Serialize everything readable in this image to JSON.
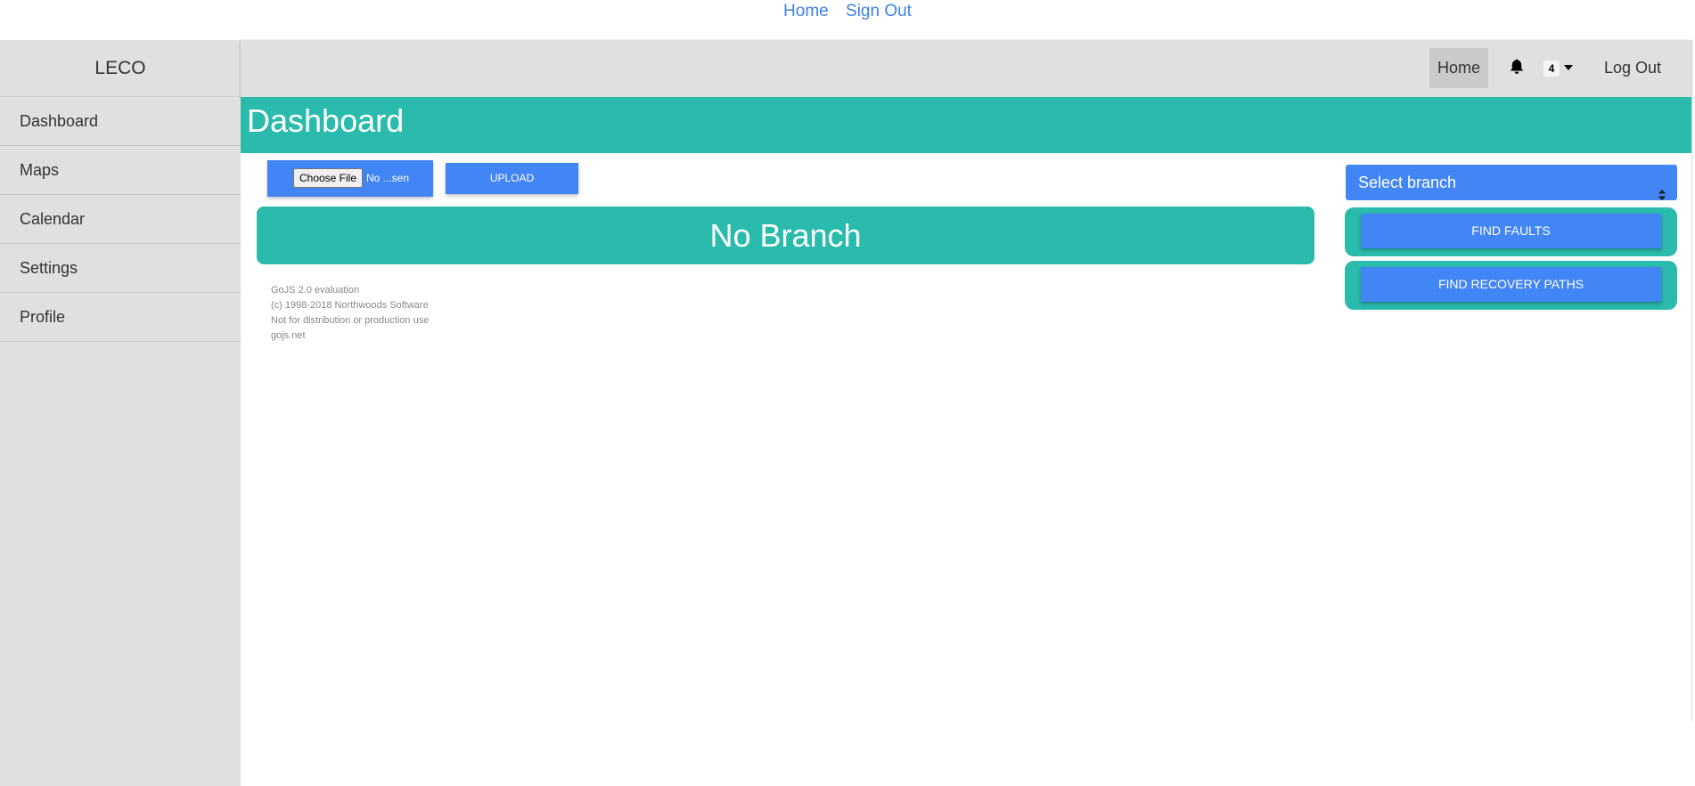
{
  "top_links": {
    "home": "Home",
    "sign_out": "Sign Out"
  },
  "sidebar": {
    "brand": "LECO",
    "items": [
      {
        "label": "Dashboard"
      },
      {
        "label": "Maps"
      },
      {
        "label": "Calendar"
      },
      {
        "label": "Settings"
      },
      {
        "label": "Profile"
      }
    ]
  },
  "navbar": {
    "home": "Home",
    "bell_icon": "bell-icon",
    "notification_count": "4",
    "dropdown_icon": "caret-down-icon",
    "logout": "Log Out"
  },
  "header": {
    "title": "Dashboard"
  },
  "upload": {
    "choose_file": "Choose File",
    "file_status": "No ...sen",
    "upload_button": "UPLOAD"
  },
  "branch_banner": "No Branch",
  "gojs_note": {
    "line1": "GoJS 2.0 evaluation",
    "line2": "(c) 1998-2018 Northwoods Software",
    "line3": "Not for distribution or production use",
    "line4": "gojs.net"
  },
  "right_panel": {
    "select_branch": "Select branch",
    "find_faults": "FIND FAULTS",
    "find_recovery_paths": "FIND RECOVERY PATHS"
  },
  "colors": {
    "teal": "#2bbbad",
    "blue": "#4285f4",
    "sidebar_gray": "#e0e0e0",
    "link_blue": "#3b82e6"
  }
}
